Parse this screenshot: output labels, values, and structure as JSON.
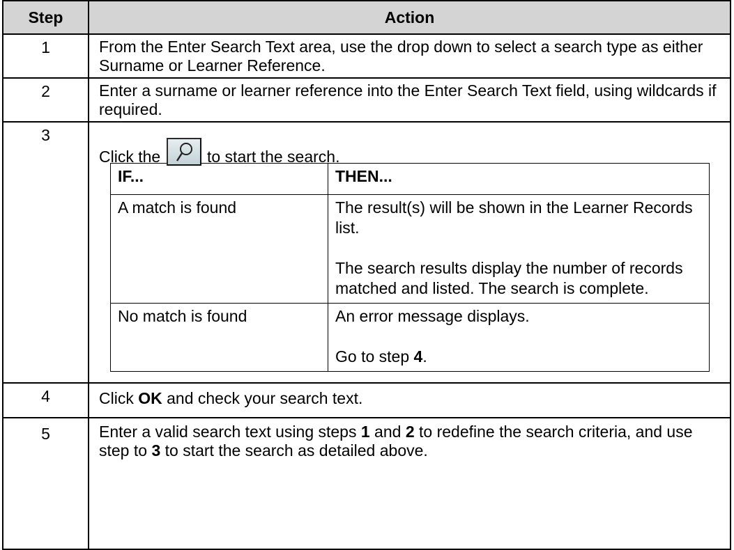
{
  "header": {
    "step": "Step",
    "action": "Action"
  },
  "rows": [
    {
      "step": "1",
      "action": "From the Enter Search Text area, use the drop down to select a search type as either Surname or Learner Reference."
    },
    {
      "step": "2",
      "action": "Enter a surname or learner reference into the Enter Search Text field, using wildcards if required."
    },
    {
      "step": "3",
      "click_before": "Click the",
      "click_after": "to start the search.",
      "icon": "magnifier-icon"
    },
    {
      "step": "4",
      "pre": "Click ",
      "bold": "OK",
      "post": " and check your search text."
    },
    {
      "step": "5",
      "pre": "Enter a valid search text using steps ",
      "b1": "1",
      "mid1": " and ",
      "b2": "2",
      "mid2": " to redefine the search criteria, and use step to ",
      "b3": "3",
      "post": " to start the search as detailed above."
    }
  ],
  "inner_table": {
    "header_if": "IF...",
    "header_then": "THEN...",
    "row1": {
      "if": "A match is found",
      "then_p1": "The result(s) will be shown in the Learner Records list.",
      "then_p2": "The search results display the number of records matched and listed.  The search is complete."
    },
    "row2": {
      "if": "No match is found",
      "then_p1": "An error message displays.",
      "then_pre": "Go to step ",
      "then_bold": "4",
      "then_post": "."
    }
  }
}
